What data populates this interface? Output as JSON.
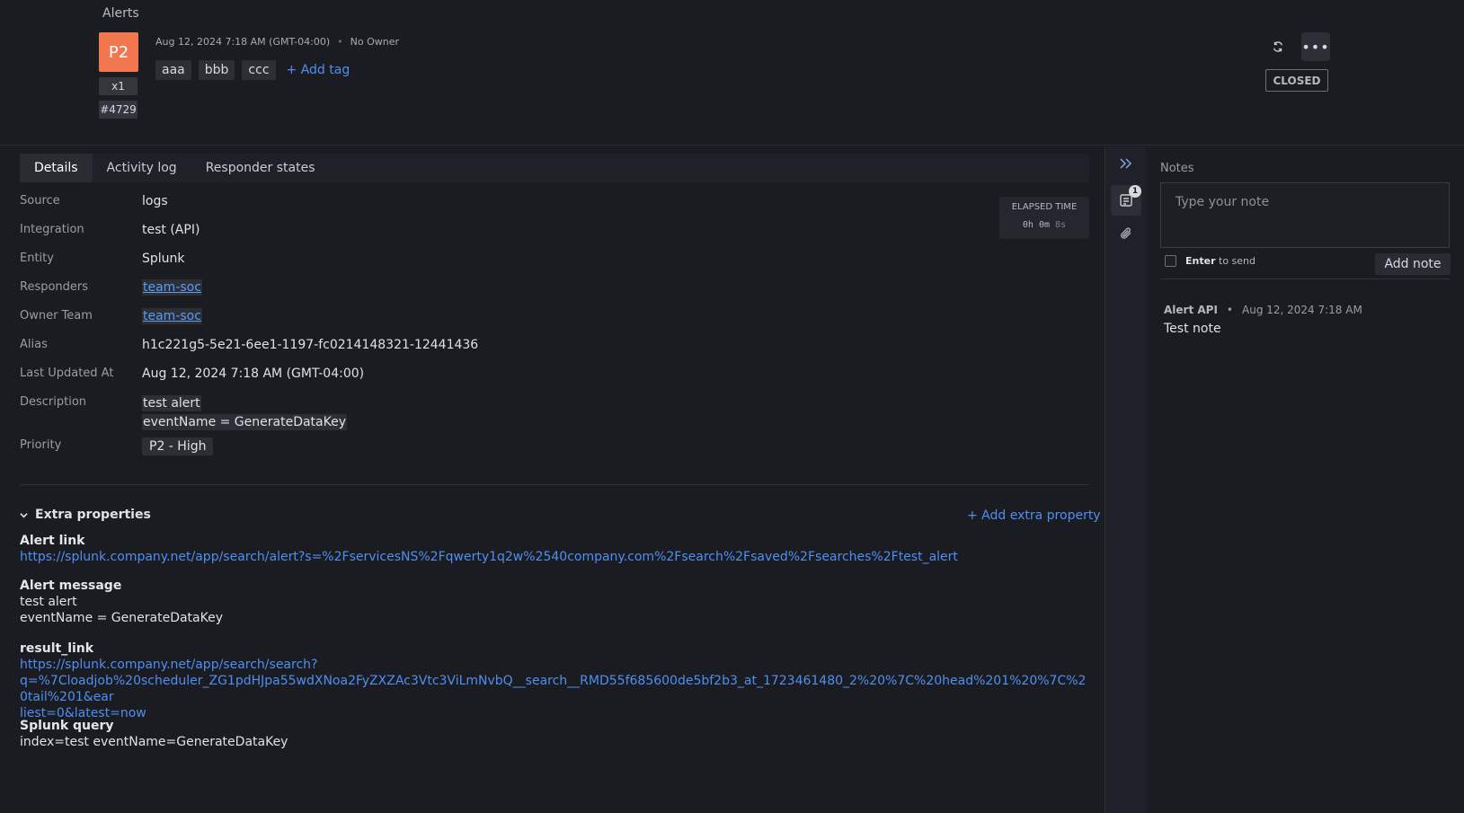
{
  "header": {
    "breadcrumb": "Alerts",
    "priority": "P2",
    "count": "x1",
    "alert_id": "#4729",
    "created": "Aug 12, 2024 7:18 AM (GMT-04:00)",
    "owner": "No Owner",
    "tags": [
      "aaa",
      "bbb",
      "ccc"
    ],
    "add_tag": "+ Add tag",
    "status": "CLOSED",
    "more_label": "•••"
  },
  "tabs": [
    "Details",
    "Activity log",
    "Responder states"
  ],
  "details": {
    "source": {
      "label": "Source",
      "value": "logs"
    },
    "integration": {
      "label": "Integration",
      "value": "test (API)"
    },
    "entity": {
      "label": "Entity",
      "value": "Splunk"
    },
    "responders": {
      "label": "Responders",
      "value": "team-soc"
    },
    "owner_team": {
      "label": "Owner Team",
      "value": "team-soc"
    },
    "alias": {
      "label": "Alias",
      "value": "h1c221g5-5e21-6ee1-1197-fc0214148321-12441436"
    },
    "last_updated": {
      "label": "Last Updated At",
      "value": "Aug 12, 2024 7:18 AM (GMT-04:00)"
    },
    "description": {
      "label": "Description",
      "line1": "test alert",
      "line2": "eventName = GenerateDataKey"
    },
    "priority": {
      "label": "Priority",
      "value": "P2 - High"
    }
  },
  "elapsed": {
    "title": "ELAPSED TIME",
    "hours": "0h",
    "minutes": "0m",
    "seconds": "8s"
  },
  "extra": {
    "title": "Extra properties",
    "add_label": "+ Add extra property",
    "alert_link": {
      "key": "Alert link",
      "value": "https://splunk.company.net/app/search/alert?s=%2FservicesNS%2Fqwerty1q2w%2540company.com%2Fsearch%2Fsaved%2Fsearches%2Ftest_alert"
    },
    "alert_message": {
      "key": "Alert message",
      "value": "test alert\neventName = GenerateDataKey"
    },
    "result_link": {
      "key": "result_link",
      "line1": "https://splunk.company.net/app/search/search?",
      "line2": "q=%7Cloadjob%20scheduler_ZG1pdHJpa55wdXNoa2FyZXZAc3Vtc3ViLmNvbQ__search__RMD55f685600de5bf2b3_at_1723461480_2%20%7C%20head%201%20%7C%20tail%201&ear",
      "line3": "liest=0&latest=now"
    },
    "splunk_query": {
      "key": "Splunk query",
      "value": "index=test eventName=GenerateDataKey"
    }
  },
  "rail": {
    "notes_count": "1"
  },
  "notes": {
    "title": "Notes",
    "placeholder": "Type your note",
    "enter_key": "Enter",
    "enter_rest": "to send",
    "add_button": "Add note",
    "items": [
      {
        "author": "Alert API",
        "time": "Aug 12, 2024 7:18 AM",
        "text": "Test note"
      }
    ]
  }
}
